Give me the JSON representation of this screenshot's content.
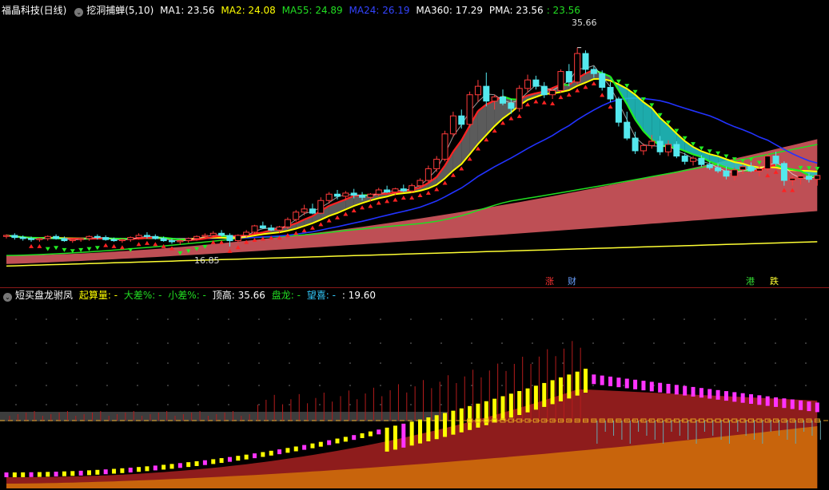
{
  "main_header": {
    "stock": "福晶科技(日线)",
    "indicator": "挖洞捕蝉(5,10)",
    "ma1": {
      "label": "MA1: 23.56",
      "color": "#ffffff"
    },
    "ma2": {
      "label": "MA2: 24.08",
      "color": "#ffff00"
    },
    "ma55": {
      "label": "MA55: 24.89",
      "color": "#22dd22"
    },
    "ma24": {
      "label": "MA24: 26.19",
      "color": "#2233ff"
    },
    "ma360": {
      "label": "MA360: 17.29",
      "color": "#ffffff"
    },
    "pma": {
      "label": "PMA: 23.56",
      "color": "#ffffff"
    },
    "pma2": {
      "label": ": 23.56",
      "color": "#22dd22"
    }
  },
  "price_labels": {
    "high": "35.66",
    "low": "16.85"
  },
  "events": [
    {
      "text": "涨",
      "color": "#ff3333"
    },
    {
      "text": "财",
      "color": "#6aa0ff"
    },
    {
      "text": "港",
      "color": "#33dd33"
    },
    {
      "text": "跌",
      "color": "#ffff33"
    }
  ],
  "sub_header": {
    "indicator": "短买盘龙驸凤",
    "qisuanliang": {
      "label": "起算量: -",
      "color": "#ffff00"
    },
    "dacha": {
      "label": "大差%: -",
      "color": "#22dd22"
    },
    "xiaocha": {
      "label": "小差%: -",
      "color": "#22dd22"
    },
    "dinggao": {
      "label": "顶高: 35.66",
      "color": "#ffffff"
    },
    "panlong": {
      "label": "盘龙: -",
      "color": "#22dd22"
    },
    "wangxi": {
      "label": "望喜: -",
      "color": "#33ccff"
    },
    "extra": {
      "label": ": 19.60",
      "color": "#ffffff"
    }
  },
  "chart_data": {
    "type": "candlestick",
    "price_range": [
      14.5,
      38.5
    ],
    "candles": [
      [
        17.8,
        18.0,
        17.6,
        17.9
      ],
      [
        17.9,
        18.1,
        17.5,
        17.7
      ],
      [
        17.7,
        17.9,
        17.4,
        17.6
      ],
      [
        17.6,
        17.8,
        17.3,
        17.5
      ],
      [
        17.5,
        17.7,
        17.3,
        17.6
      ],
      [
        17.6,
        17.9,
        17.4,
        17.8
      ],
      [
        17.8,
        18.0,
        17.5,
        17.6
      ],
      [
        17.6,
        17.8,
        17.3,
        17.4
      ],
      [
        17.4,
        17.6,
        17.2,
        17.5
      ],
      [
        17.5,
        17.7,
        17.3,
        17.6
      ],
      [
        17.6,
        17.9,
        17.4,
        17.8
      ],
      [
        17.8,
        18.0,
        17.5,
        17.7
      ],
      [
        17.7,
        17.9,
        17.4,
        17.5
      ],
      [
        17.5,
        17.7,
        17.3,
        17.4
      ],
      [
        17.4,
        17.6,
        17.2,
        17.5
      ],
      [
        17.5,
        17.8,
        17.3,
        17.7
      ],
      [
        17.7,
        18.1,
        17.5,
        17.9
      ],
      [
        17.9,
        18.2,
        17.6,
        17.8
      ],
      [
        17.8,
        18.0,
        17.5,
        17.6
      ],
      [
        17.6,
        17.8,
        17.3,
        17.4
      ],
      [
        17.4,
        17.6,
        17.1,
        17.3
      ],
      [
        17.3,
        17.5,
        17.0,
        17.4
      ],
      [
        17.4,
        17.7,
        17.2,
        17.6
      ],
      [
        17.6,
        17.9,
        17.4,
        17.8
      ],
      [
        17.8,
        18.1,
        17.6,
        17.9
      ],
      [
        17.9,
        18.3,
        17.7,
        18.1
      ],
      [
        18.1,
        18.4,
        17.8,
        17.9
      ],
      [
        17.9,
        18.1,
        16.85,
        17.4
      ],
      [
        17.4,
        18.0,
        17.2,
        17.9
      ],
      [
        17.9,
        18.4,
        17.7,
        18.2
      ],
      [
        18.2,
        18.9,
        18.0,
        18.8
      ],
      [
        18.8,
        19.2,
        18.5,
        18.6
      ],
      [
        18.6,
        18.9,
        18.3,
        18.4
      ],
      [
        18.4,
        18.8,
        18.1,
        18.7
      ],
      [
        18.7,
        19.6,
        18.5,
        19.4
      ],
      [
        19.4,
        20.3,
        19.2,
        20.1
      ],
      [
        20.1,
        20.8,
        19.8,
        20.4
      ],
      [
        20.4,
        20.9,
        19.9,
        20.0
      ],
      [
        20.0,
        21.5,
        19.9,
        21.2
      ],
      [
        21.2,
        22.0,
        20.9,
        21.8
      ],
      [
        21.8,
        22.2,
        21.3,
        21.6
      ],
      [
        21.6,
        22.1,
        21.2,
        21.9
      ],
      [
        21.9,
        22.3,
        21.4,
        21.7
      ],
      [
        21.7,
        22.0,
        21.2,
        21.5
      ],
      [
        21.5,
        21.9,
        21.1,
        21.8
      ],
      [
        21.8,
        22.4,
        21.6,
        22.2
      ],
      [
        22.2,
        22.6,
        21.9,
        22.0
      ],
      [
        22.0,
        22.4,
        21.7,
        22.3
      ],
      [
        22.3,
        22.7,
        22.0,
        22.1
      ],
      [
        22.1,
        22.8,
        21.9,
        22.6
      ],
      [
        22.6,
        23.3,
        22.4,
        23.1
      ],
      [
        23.1,
        24.5,
        22.9,
        24.2
      ],
      [
        24.2,
        25.4,
        23.9,
        25.1
      ],
      [
        25.1,
        27.8,
        24.9,
        27.5
      ],
      [
        27.5,
        29.6,
        27.2,
        29.2
      ],
      [
        29.2,
        29.8,
        28.0,
        28.4
      ],
      [
        28.4,
        31.5,
        28.1,
        31.2
      ],
      [
        31.2,
        32.6,
        30.5,
        32.0
      ],
      [
        32.0,
        33.3,
        30.1,
        30.6
      ],
      [
        30.6,
        31.2,
        29.8,
        31.0
      ],
      [
        31.0,
        31.7,
        30.2,
        30.4
      ],
      [
        30.4,
        30.8,
        29.4,
        29.9
      ],
      [
        29.9,
        32.1,
        29.6,
        31.8
      ],
      [
        31.8,
        33.1,
        31.4,
        32.6
      ],
      [
        32.6,
        33.0,
        31.7,
        32.0
      ],
      [
        32.0,
        32.4,
        30.9,
        31.2
      ],
      [
        31.2,
        31.9,
        30.8,
        31.6
      ],
      [
        31.6,
        33.6,
        31.4,
        33.4
      ],
      [
        33.4,
        34.1,
        32.0,
        32.4
      ],
      [
        32.4,
        35.66,
        32.2,
        35.1
      ],
      [
        35.1,
        35.4,
        33.2,
        33.6
      ],
      [
        33.6,
        33.9,
        32.8,
        33.2
      ],
      [
        33.2,
        33.5,
        31.6,
        31.9
      ],
      [
        31.9,
        32.4,
        30.5,
        30.8
      ],
      [
        30.8,
        31.0,
        28.2,
        28.6
      ],
      [
        28.6,
        29.6,
        26.9,
        27.1
      ],
      [
        27.1,
        27.7,
        25.6,
        25.9
      ],
      [
        25.9,
        26.6,
        25.5,
        26.4
      ],
      [
        26.4,
        27.4,
        26.1,
        26.8
      ],
      [
        26.8,
        27.3,
        25.5,
        25.8
      ],
      [
        25.8,
        26.9,
        25.4,
        26.5
      ],
      [
        26.5,
        26.8,
        25.2,
        25.4
      ],
      [
        25.4,
        25.7,
        24.6,
        24.9
      ],
      [
        24.9,
        25.4,
        24.5,
        25.2
      ],
      [
        25.2,
        25.5,
        24.4,
        24.6
      ],
      [
        24.6,
        24.9,
        24.1,
        24.3
      ],
      [
        24.3,
        24.7,
        23.8,
        24.0
      ],
      [
        24.0,
        24.4,
        23.2,
        23.5
      ],
      [
        23.5,
        24.3,
        23.1,
        24.1
      ],
      [
        24.1,
        24.6,
        23.7,
        24.4
      ],
      [
        24.4,
        24.8,
        23.9,
        24.0
      ],
      [
        24.0,
        24.5,
        23.5,
        24.2
      ],
      [
        24.2,
        25.6,
        24.0,
        25.4
      ],
      [
        25.4,
        25.8,
        24.5,
        24.7
      ],
      [
        24.7,
        24.9,
        22.6,
        23.1
      ],
      [
        23.1,
        23.5,
        22.6,
        23.3
      ],
      [
        23.3,
        23.7,
        22.7,
        23.5
      ],
      [
        23.5,
        23.8,
        22.9,
        23.2
      ],
      [
        23.2,
        23.6,
        22.6,
        23.56
      ]
    ]
  }
}
